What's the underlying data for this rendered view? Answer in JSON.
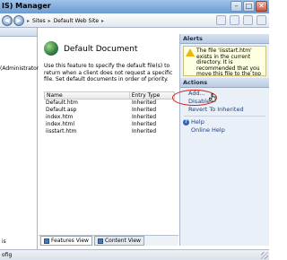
{
  "window": {
    "title": "IS) Manager",
    "controls": [
      "–",
      "□",
      "✕"
    ]
  },
  "address": {
    "breadcrumbs": [
      "Sites",
      "Default Web Site"
    ]
  },
  "left": {
    "user_text": "(Administrator)",
    "bottom_label": "is"
  },
  "feature": {
    "icon": "globe-document-icon",
    "title": "Default Document",
    "description": "Use this feature to specify the default file(s) to return when a client does not request a specific file. Set default documents in order of priority."
  },
  "table": {
    "columns": [
      "Name",
      "Entry Type"
    ],
    "rows": [
      [
        "Default.htm",
        "Inherited"
      ],
      [
        "Default.asp",
        "Inherited"
      ],
      [
        "index.htm",
        "Inherited"
      ],
      [
        "index.html",
        "Inherited"
      ],
      [
        "iisstart.htm",
        "Inherited"
      ]
    ]
  },
  "view_tabs": [
    "Features View",
    "Content View"
  ],
  "alerts": {
    "header": "Alerts",
    "message": "The file 'iisstart.htm' exists in the current directory. It is recommended that you move this file to the top of the list to improve performance."
  },
  "actions": {
    "header": "Actions",
    "items": [
      "Add...",
      "Disable",
      "Revert To Inherited"
    ],
    "help": [
      "Help",
      "Online Help"
    ]
  },
  "status": {
    "text": "ofig"
  }
}
